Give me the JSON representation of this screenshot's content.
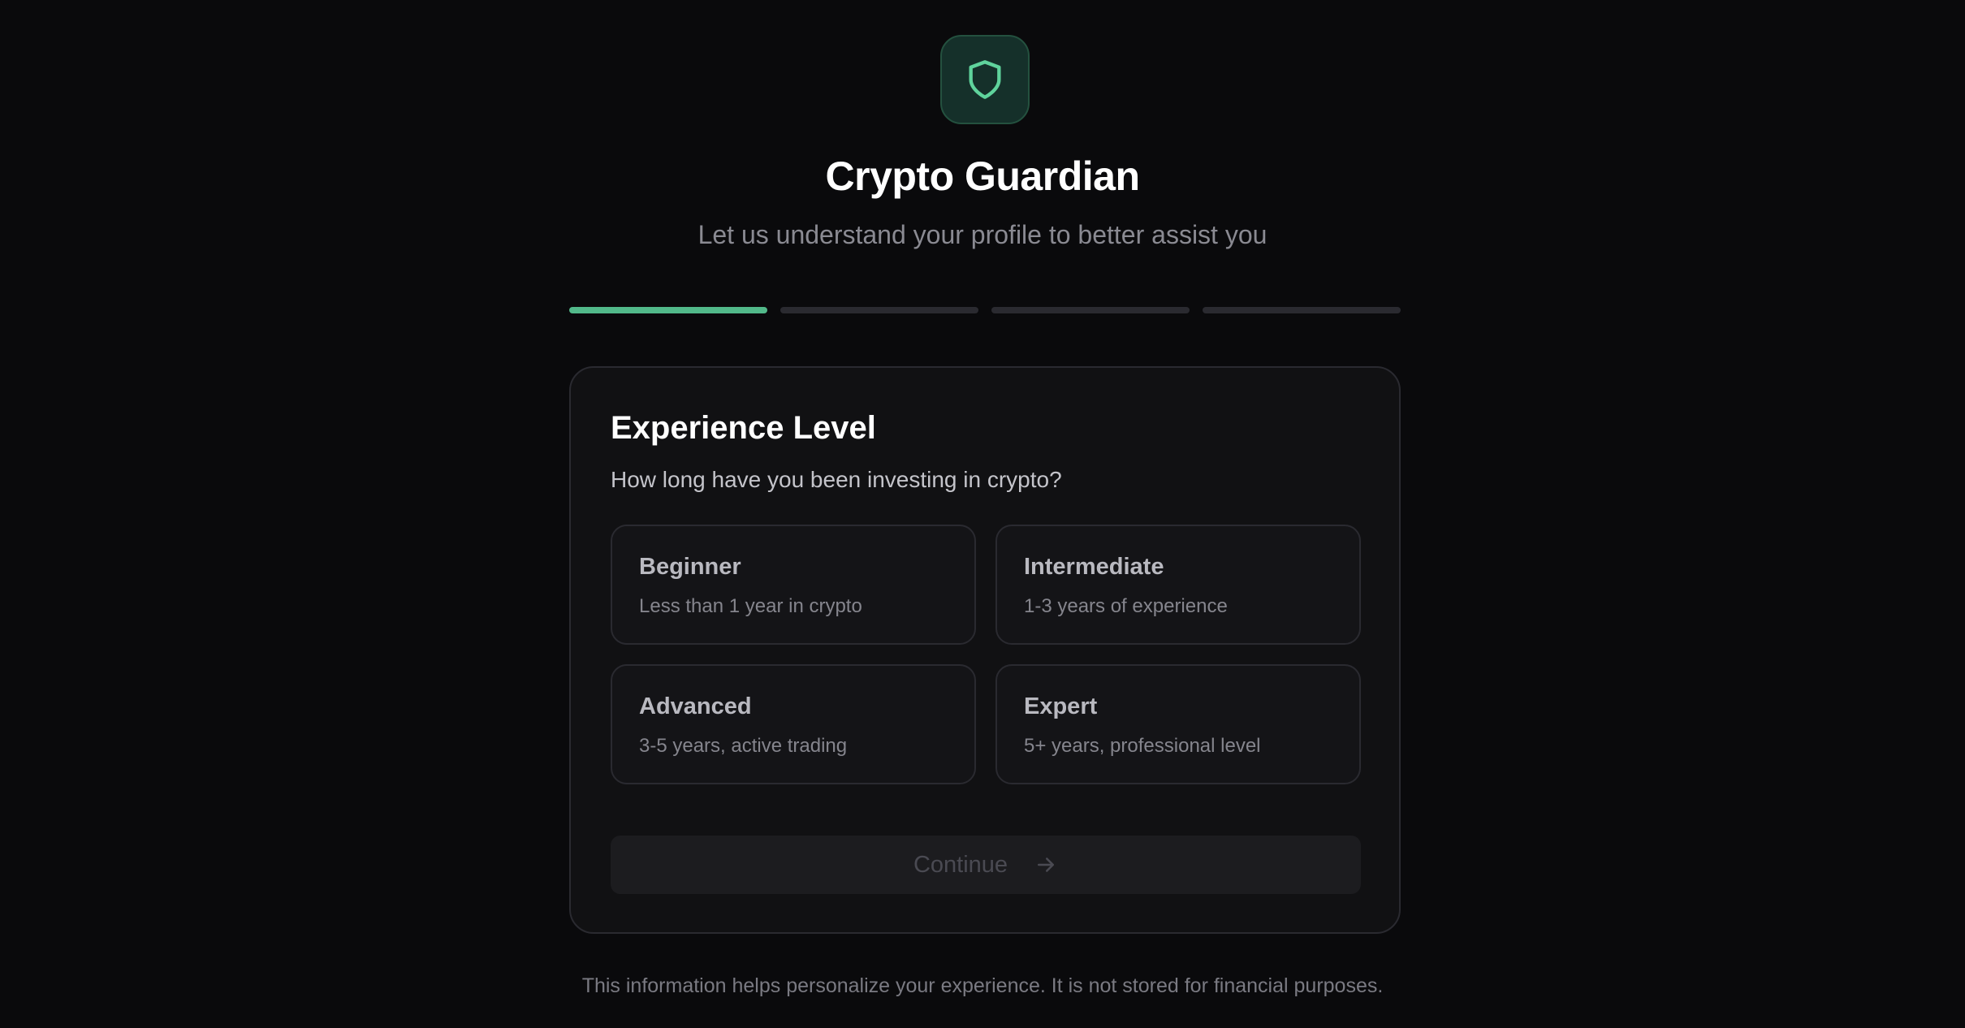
{
  "header": {
    "logo_icon": "shield-icon",
    "title": "Crypto Guardian",
    "subtitle": "Let us understand your profile to better assist you"
  },
  "progress": {
    "total_steps": 4,
    "current_step": 1,
    "accent_color": "#52b98a"
  },
  "card": {
    "title": "Experience Level",
    "question": "How long have you been investing in crypto?",
    "options": [
      {
        "title": "Beginner",
        "description": "Less than 1 year in crypto"
      },
      {
        "title": "Intermediate",
        "description": "1-3 years of experience"
      },
      {
        "title": "Advanced",
        "description": "3-5 years, active trading"
      },
      {
        "title": "Expert",
        "description": "5+ years, professional level"
      }
    ],
    "continue_label": "Continue",
    "continue_icon": "arrow-right-icon"
  },
  "footer": {
    "note": "This information helps personalize your experience. It is not stored for financial purposes."
  }
}
